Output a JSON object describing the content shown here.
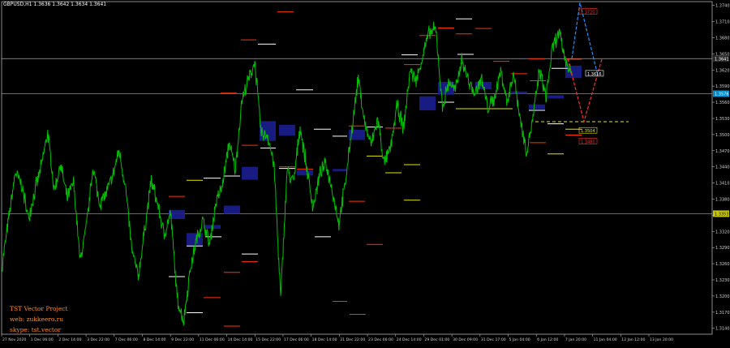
{
  "header": {
    "symbol_tf": "GBPUSD,H1",
    "ohlc": "1.3636 1.3642 1.3634 1.3641"
  },
  "branding": {
    "line1": "TST Vector Project",
    "line2": "web: zukkeero.ru",
    "line3": "skype: tst.vector"
  },
  "colors": {
    "background": "#000000",
    "price_line": "#00c000",
    "axis_text": "#cfcfcf",
    "border": "#b0b0b0",
    "zone_fill": "#1a1d8c",
    "level_red": "#ff3300",
    "level_white": "#ffffff",
    "level_yellow": "#e6e600",
    "hline_gray": "#8a8a8a",
    "hline_cyan": "#00a2e8",
    "hline_olive": "#9c9c00",
    "projection_blue": "#1e90ff",
    "projection_red": "#ff3030",
    "branding": "#ff8c1a"
  },
  "chart_data": {
    "type": "line",
    "title": "",
    "symbol": "GBPUSD",
    "timeframe": "H1",
    "ylim": [
      1.3129,
      1.3747
    ],
    "y_ticks": [
      "1.3740",
      "1.3710",
      "1.3680",
      "1.3650",
      "1.3620",
      "1.3590",
      "1.3560",
      "1.3530",
      "1.3500",
      "1.3470",
      "1.3440",
      "1.3410",
      "1.3380",
      "1.3350",
      "1.3320",
      "1.3290",
      "1.3260",
      "1.3230",
      "1.3200",
      "1.3170",
      "1.3140"
    ],
    "x_ticks": [
      "27 Nov 2020",
      "1 Dec 06:00",
      "2 Dec 14:00",
      "3 Dec 22:00",
      "7 Dec 06:00",
      "8 Dec 14:00",
      "9 Dec 22:00",
      "11 Dec 06:00",
      "14 Dec 14:00",
      "15 Dec 22:00",
      "17 Dec 06:00",
      "18 Dec 14:00",
      "21 Dec 22:00",
      "23 Dec 06:00",
      "24 Dec 14:00",
      "29 Dec 01:00",
      "30 Dec 09:00",
      "31 Dec 17:00",
      "5 Jan 04:00",
      "6 Jan 12:00",
      "7 Jan 20:00",
      "11 Jan 04:00",
      "12 Jan 12:00",
      "13 Jan 20:00"
    ],
    "series": [
      {
        "name": "",
        "values": [
          1.3262,
          1.3345,
          1.343,
          1.3405,
          1.3345,
          1.3395,
          1.344,
          1.3505,
          1.3395,
          1.3445,
          1.338,
          1.341,
          1.3265,
          1.333,
          1.344,
          1.3372,
          1.339,
          1.342,
          1.347,
          1.3405,
          1.3285,
          1.3235,
          1.3325,
          1.3415,
          1.337,
          1.3312,
          1.3355,
          1.3195,
          1.3152,
          1.3248,
          1.3305,
          1.334,
          1.3295,
          1.3375,
          1.3405,
          1.3485,
          1.3435,
          1.3565,
          1.36,
          1.3635,
          1.35,
          1.35,
          1.344,
          1.3195,
          1.3435,
          1.341,
          1.3515,
          1.344,
          1.3365,
          1.3425,
          1.3445,
          1.3395,
          1.3335,
          1.341,
          1.351,
          1.3605,
          1.352,
          1.348,
          1.353,
          1.3445,
          1.3475,
          1.3555,
          1.351,
          1.362,
          1.36,
          1.365,
          1.369,
          1.3695,
          1.355,
          1.36,
          1.358,
          1.364,
          1.36,
          1.3575,
          1.3605,
          1.355,
          1.3565,
          1.362,
          1.356,
          1.3615,
          1.353,
          1.347,
          1.353,
          1.362,
          1.357,
          1.366,
          1.369,
          1.364,
          1.361
        ]
      }
    ],
    "current_price": "1.3641",
    "price_labels": [
      {
        "text": "1.3641",
        "value": 1.3641,
        "color": "#ffffff",
        "fill": "#2a2a2a"
      },
      {
        "text": "1.3576",
        "value": 1.3576,
        "color": "#ffffff",
        "fill": "#008ccf"
      },
      {
        "text": "1.3353",
        "value": 1.3353,
        "color": "#000000",
        "fill": "#c8c800"
      }
    ],
    "horizontal_lines": [
      {
        "value": 1.3641,
        "color": "#8a8a8a"
      },
      {
        "value": 1.3576,
        "color": "#00a2e8"
      },
      {
        "value": 1.3353,
        "color": "#9c9c00"
      }
    ],
    "zones": [
      {
        "x0": 208,
        "x1": 228,
        "y0": 1.336,
        "y1": 1.3343
      },
      {
        "x0": 230,
        "x1": 250,
        "y0": 1.3317,
        "y1": 1.3294
      },
      {
        "x0": 251,
        "x1": 272,
        "y0": 1.3332,
        "y1": 1.3325
      },
      {
        "x0": 276,
        "x1": 296,
        "y0": 1.3368,
        "y1": 1.3353
      },
      {
        "x0": 298,
        "x1": 318,
        "y0": 1.344,
        "y1": 1.3416
      },
      {
        "x0": 320,
        "x1": 340,
        "y0": 1.3525,
        "y1": 1.3488
      },
      {
        "x0": 344,
        "x1": 364,
        "y0": 1.3518,
        "y1": 1.3498
      },
      {
        "x0": 366,
        "x1": 386,
        "y0": 1.3434,
        "y1": 1.3424
      },
      {
        "x0": 410,
        "x1": 428,
        "y0": 1.3436,
        "y1": 1.3432
      },
      {
        "x0": 430,
        "x1": 450,
        "y0": 1.3509,
        "y1": 1.349
      },
      {
        "x0": 517,
        "x1": 537,
        "y0": 1.3571,
        "y1": 1.3545
      },
      {
        "x0": 540,
        "x1": 560,
        "y0": 1.3598,
        "y1": 1.3574
      },
      {
        "x0": 586,
        "x1": 606,
        "y0": 1.3598,
        "y1": 1.3584
      },
      {
        "x0": 630,
        "x1": 650,
        "y0": 1.358,
        "y1": 1.3576
      },
      {
        "x0": 652,
        "x1": 672,
        "y0": 1.3556,
        "y1": 1.3547
      },
      {
        "x0": 675,
        "x1": 695,
        "y0": 1.3573,
        "y1": 1.3567
      },
      {
        "x0": 697,
        "x1": 717,
        "y0": 1.3628,
        "y1": 1.3605
      }
    ],
    "level_marks": [
      {
        "x0": 342,
        "x1": 362,
        "value": 1.3728,
        "color": "#ff3300"
      },
      {
        "x0": 297,
        "x1": 316,
        "value": 1.3676,
        "color": "#ff3300"
      },
      {
        "x0": 318,
        "x1": 340,
        "value": 1.3668,
        "color": "#ffffff"
      },
      {
        "x0": 272,
        "x1": 292,
        "value": 1.3577,
        "color": "#ff3300"
      },
      {
        "x0": 365,
        "x1": 386,
        "value": 1.3583,
        "color": "#ffffff"
      },
      {
        "x0": 387,
        "x1": 408,
        "value": 1.351,
        "color": "#ffffff"
      },
      {
        "x0": 410,
        "x1": 428,
        "value": 1.3497,
        "color": "#ffffff"
      },
      {
        "x0": 430,
        "x1": 450,
        "value": 1.3516,
        "color": "#ff3300"
      },
      {
        "x0": 452,
        "x1": 472,
        "value": 1.3514,
        "color": "#ffffff"
      },
      {
        "x0": 475,
        "x1": 495,
        "value": 1.3512,
        "color": "#ff3300"
      },
      {
        "x0": 321,
        "x1": 340,
        "value": 1.3475,
        "color": "#ffffff"
      },
      {
        "x0": 298,
        "x1": 318,
        "value": 1.348,
        "color": "#ff3300"
      },
      {
        "x0": 344,
        "x1": 364,
        "value": 1.344,
        "color": "#ff3300"
      },
      {
        "x0": 344,
        "x1": 364,
        "value": 1.3437,
        "color": "#ffffff"
      },
      {
        "x0": 366,
        "x1": 386,
        "value": 1.3436,
        "color": "#ff3300"
      },
      {
        "x0": 452,
        "x1": 472,
        "value": 1.346,
        "color": "#e6e600"
      },
      {
        "x0": 475,
        "x1": 495,
        "value": 1.3429,
        "color": "#e6e600"
      },
      {
        "x0": 498,
        "x1": 518,
        "value": 1.3444,
        "color": "#e6e600"
      },
      {
        "x0": 230,
        "x1": 250,
        "value": 1.3415,
        "color": "#e6e600"
      },
      {
        "x0": 251,
        "x1": 272,
        "value": 1.3419,
        "color": "#ffffff"
      },
      {
        "x0": 276,
        "x1": 296,
        "value": 1.3423,
        "color": "#ffffff"
      },
      {
        "x0": 208,
        "x1": 228,
        "value": 1.3385,
        "color": "#ff3300"
      },
      {
        "x0": 253,
        "x1": 273,
        "value": 1.331,
        "color": "#ffffff"
      },
      {
        "x0": 230,
        "x1": 250,
        "value": 1.3293,
        "color": "#ffffff"
      },
      {
        "x0": 298,
        "x1": 318,
        "value": 1.3278,
        "color": "#ffffff"
      },
      {
        "x0": 298,
        "x1": 318,
        "value": 1.3264,
        "color": "#ff3300"
      },
      {
        "x0": 276,
        "x1": 296,
        "value": 1.3244,
        "color": "#ff3300"
      },
      {
        "x0": 208,
        "x1": 228,
        "value": 1.3236,
        "color": "#ffffff"
      },
      {
        "x0": 251,
        "x1": 272,
        "value": 1.3197,
        "color": "#ff3300"
      },
      {
        "x0": 230,
        "x1": 250,
        "value": 1.3169,
        "color": "#ffffff"
      },
      {
        "x0": 276,
        "x1": 296,
        "value": 1.3144,
        "color": "#ff3300"
      },
      {
        "x0": 388,
        "x1": 408,
        "value": 1.331,
        "color": "#ffffff"
      },
      {
        "x0": 410,
        "x1": 428,
        "value": 1.319,
        "color": "#ff3300"
      },
      {
        "x0": 430,
        "x1": 450,
        "value": 1.3376,
        "color": "#ff3300"
      },
      {
        "x0": 452,
        "x1": 472,
        "value": 1.3296,
        "color": "#ff3300"
      },
      {
        "x0": 431,
        "x1": 451,
        "value": 1.3166,
        "color": "#ff3300"
      },
      {
        "x0": 498,
        "x1": 518,
        "value": 1.3378,
        "color": "#e6e600"
      },
      {
        "x0": 562,
        "x1": 582,
        "value": 1.3715,
        "color": "#ffffff"
      },
      {
        "x0": 517,
        "x1": 537,
        "value": 1.3684,
        "color": "#ff3300"
      },
      {
        "x0": 540,
        "x1": 560,
        "value": 1.3698,
        "color": "#ff3300"
      },
      {
        "x0": 562,
        "x1": 582,
        "value": 1.3687,
        "color": "#ff3300"
      },
      {
        "x0": 586,
        "x1": 606,
        "value": 1.3697,
        "color": "#ff3300"
      },
      {
        "x0": 495,
        "x1": 515,
        "value": 1.3648,
        "color": "#ffffff"
      },
      {
        "x0": 498,
        "x1": 518,
        "value": 1.363,
        "color": "#ff3300"
      },
      {
        "x0": 564,
        "x1": 584,
        "value": 1.3649,
        "color": "#ffffff"
      },
      {
        "x0": 608,
        "x1": 628,
        "value": 1.3636,
        "color": "#ff3300"
      },
      {
        "x0": 630,
        "x1": 650,
        "value": 1.3613,
        "color": "#ff3300"
      },
      {
        "x0": 652,
        "x1": 672,
        "value": 1.3641,
        "color": "#ff3300"
      },
      {
        "x0": 653,
        "x1": 673,
        "value": 1.36,
        "color": "#ff3300"
      },
      {
        "x0": 562,
        "x1": 632,
        "value": 1.3548,
        "color": "#e6e600"
      },
      {
        "x0": 540,
        "x1": 560,
        "value": 1.356,
        "color": "#ffffff"
      },
      {
        "x0": 697,
        "x1": 717,
        "value": 1.364,
        "color": "#ff3300"
      },
      {
        "x0": 680,
        "x1": 700,
        "value": 1.3623,
        "color": "#ffffff"
      },
      {
        "x0": 652,
        "x1": 672,
        "value": 1.3545,
        "color": "#ffffff"
      },
      {
        "x0": 675,
        "x1": 695,
        "value": 1.352,
        "color": "#ffffff"
      },
      {
        "x0": 653,
        "x1": 673,
        "value": 1.3485,
        "color": "#ff3300"
      },
      {
        "x0": 675,
        "x1": 695,
        "value": 1.3464,
        "color": "#e6e600"
      },
      {
        "x0": 697,
        "x1": 717,
        "value": 1.3499,
        "color": "#ff3300"
      },
      {
        "x0": 697,
        "x1": 717,
        "value": 1.351,
        "color": "#e6e600"
      }
    ],
    "dashed_level": {
      "x0": 660,
      "x1": 775,
      "value": 1.3524,
      "color": "#e6e600"
    },
    "projections": [
      {
        "color": "#1e90ff",
        "points": [
          [
            705,
            1.3641
          ],
          [
            715,
            1.3745
          ],
          [
            737,
            1.361
          ]
        ]
      },
      {
        "color": "#ff3030",
        "points": [
          [
            700,
            1.3641
          ],
          [
            720,
            1.3524
          ],
          [
            742,
            1.364
          ]
        ]
      }
    ],
    "projection_tags": [
      {
        "text": "1.3720",
        "x": 732,
        "value": 1.3728,
        "color": "#ff3030"
      },
      {
        "text": "1.3616",
        "x": 740,
        "value": 1.3613,
        "color": "#ffffff"
      },
      {
        "text": "1.3504",
        "x": 732,
        "value": 1.3507,
        "color": "#e6e600"
      },
      {
        "text": "1.3480",
        "x": 732,
        "value": 1.3487,
        "color": "#ff3030"
      }
    ],
    "grid": false,
    "legend": "none"
  }
}
